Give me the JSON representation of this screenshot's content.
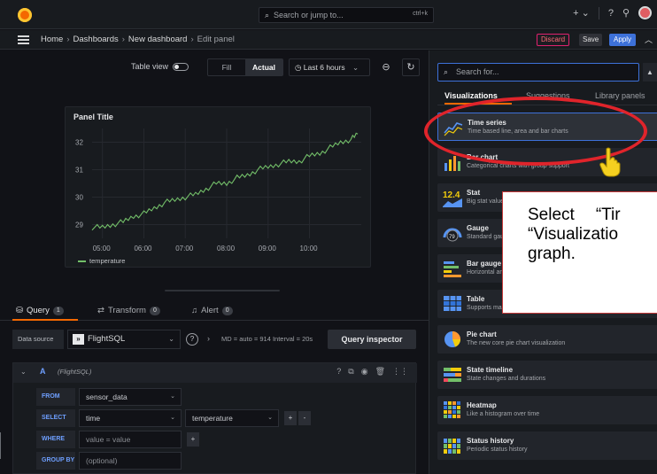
{
  "topbar": {
    "search_placeholder": "Search or jump to...",
    "search_shortcut": "ctrl+k",
    "plus_label": "+ ⌄"
  },
  "breadcrumb": {
    "items": [
      "Home",
      "Dashboards",
      "New dashboard",
      "Edit panel"
    ],
    "separator": "›"
  },
  "actions": {
    "discard": "Discard",
    "save": "Save",
    "apply": "Apply"
  },
  "toolbar": {
    "table_view": "Table view",
    "fill": "Fill",
    "actual": "Actual",
    "time_range": "Last 6 hours"
  },
  "panel": {
    "title": "Panel Title",
    "legend_label": "temperature"
  },
  "chart_data": {
    "type": "line",
    "title": "Panel Title",
    "x_ticks": [
      "05:00",
      "06:00",
      "07:00",
      "08:00",
      "09:00",
      "10:00"
    ],
    "y_ticks": [
      29,
      30,
      31,
      32
    ],
    "ylim": [
      28.5,
      32.5
    ],
    "series": [
      {
        "name": "temperature",
        "color": "#73bf69",
        "points": [
          [
            "04:45",
            28.9
          ],
          [
            "05:00",
            28.9
          ],
          [
            "05:15",
            29.0
          ],
          [
            "05:30",
            29.1
          ],
          [
            "05:45",
            29.3
          ],
          [
            "06:00",
            29.4
          ],
          [
            "06:15",
            29.6
          ],
          [
            "06:30",
            29.8
          ],
          [
            "06:45",
            29.9
          ],
          [
            "07:00",
            30.0
          ],
          [
            "07:15",
            30.1
          ],
          [
            "07:30",
            30.3
          ],
          [
            "07:45",
            30.5
          ],
          [
            "08:00",
            30.5
          ],
          [
            "08:15",
            30.7
          ],
          [
            "08:30",
            30.8
          ],
          [
            "08:45",
            31.0
          ],
          [
            "09:00",
            31.1
          ],
          [
            "09:15",
            31.2
          ],
          [
            "09:30",
            31.3
          ],
          [
            "09:45",
            31.3
          ],
          [
            "10:00",
            31.5
          ],
          [
            "10:15",
            31.6
          ],
          [
            "10:30",
            31.8
          ],
          [
            "10:45",
            32.0
          ],
          [
            "11:00",
            32.1
          ],
          [
            "11:10",
            32.3
          ]
        ]
      }
    ],
    "grid": true,
    "legend": "bottom-left"
  },
  "query_tabs": [
    {
      "label": "Query",
      "count": "1"
    },
    {
      "label": "Transform",
      "count": "0"
    },
    {
      "label": "Alert",
      "count": "0"
    }
  ],
  "datasource": {
    "label": "Data source",
    "name": "FlightSQL",
    "meta": "MD = auto = 914   Interval = 20s",
    "inspector": "Query inspector"
  },
  "query": {
    "ref": "A",
    "source": "(FlightSQL)",
    "rows": [
      {
        "keyword": "FROM",
        "field1": "sensor_data"
      },
      {
        "keyword": "SELECT",
        "field1": "time",
        "field2": "temperature"
      },
      {
        "keyword": "WHERE",
        "field1": "value = value"
      },
      {
        "keyword": "GROUP BY",
        "field1": "(optional)"
      }
    ]
  },
  "viz_picker": {
    "search_placeholder": "Search for...",
    "tabs": [
      "Visualizations",
      "Suggestions",
      "Library panels"
    ],
    "items": [
      {
        "name": "Time series",
        "desc": "Time based line, area and bar charts",
        "icon": "time-series-icon"
      },
      {
        "name": "Bar chart",
        "desc": "Categorical charts with group support",
        "icon": "bar-chart-icon"
      },
      {
        "name": "Stat",
        "desc": "Big stat values",
        "icon": "stat-icon",
        "icon_text": "12.4"
      },
      {
        "name": "Gauge",
        "desc": "Standard gauge",
        "icon": "gauge-icon",
        "icon_text": "79"
      },
      {
        "name": "Bar gauge",
        "desc": "Horizontal and vertical gauges",
        "icon": "bar-gauge-icon"
      },
      {
        "name": "Table",
        "desc": "Supports many formats",
        "icon": "table-icon"
      },
      {
        "name": "Pie chart",
        "desc": "The new core pie chart visualization",
        "icon": "pie-chart-icon"
      },
      {
        "name": "State timeline",
        "desc": "State changes and durations",
        "icon": "state-timeline-icon"
      },
      {
        "name": "Heatmap",
        "desc": "Like a histogram over time",
        "icon": "heatmap-icon"
      },
      {
        "name": "Status history",
        "desc": "Periodic status history",
        "icon": "status-history-icon"
      }
    ]
  },
  "annotation": {
    "line1a": "Select",
    "line1b": "“Tir",
    "line2": "“Visualizatio",
    "line3": "graph."
  },
  "colors": {
    "accent_orange": "#f46800",
    "primary_blue": "#3d71d9",
    "series_green": "#73bf69",
    "highlight_red": "#e0242b"
  }
}
